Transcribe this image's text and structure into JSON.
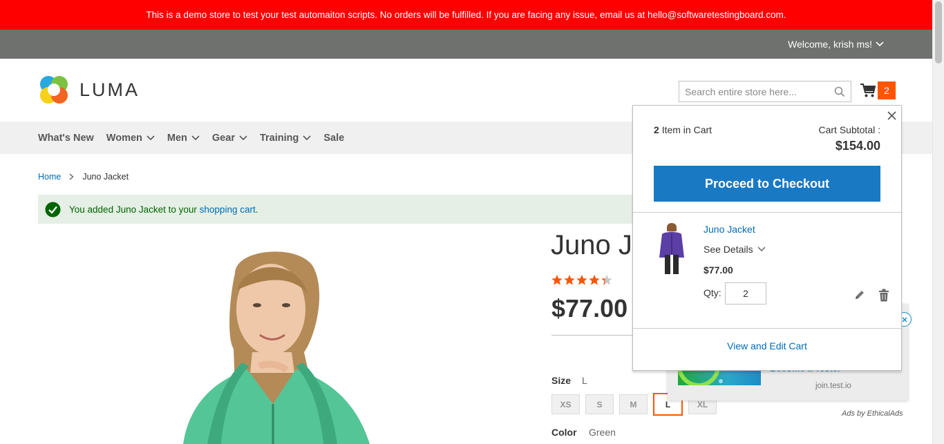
{
  "banner": {
    "text": "This is a demo store to test your test automaiton scripts. No orders will be fulfilled. If you are facing any issue, email us at hello@softwaretestingboard.com."
  },
  "header": {
    "welcome": "Welcome, krish ms!",
    "logo_text": "LUMA",
    "search_placeholder": "Search entire store here...",
    "cart_count": "2"
  },
  "nav": {
    "items": [
      "What's New",
      "Women",
      "Men",
      "Gear",
      "Training",
      "Sale"
    ]
  },
  "breadcrumb": {
    "home": "Home",
    "current": "Juno Jacket"
  },
  "message": {
    "prefix": "You added Juno Jacket to your ",
    "link": "shopping cart",
    "suffix": "."
  },
  "product": {
    "title": "Juno Jacket",
    "price": "$77.00",
    "rating_percent": 86,
    "size_label": "Size",
    "size_value": "L",
    "sizes": [
      "XS",
      "S",
      "M",
      "L",
      "XL"
    ],
    "selected_size": "L",
    "color_label": "Color",
    "color_value": "Green"
  },
  "minicart": {
    "item_count": "2",
    "items_label": "Item in Cart",
    "subtotal_label": "Cart Subtotal :",
    "subtotal": "$154.00",
    "checkout_label": "Proceed to Checkout",
    "item": {
      "name": "Juno Jacket",
      "see_details": "See Details",
      "price": "$77.00",
      "qty_label": "Qty:",
      "qty": "2"
    },
    "view_cart": "View and Edit Cart"
  },
  "ad": {
    "headline": "Become a Tester",
    "domain": "join.test.io",
    "attribution": "Ads by EthicalAds"
  },
  "colors": {
    "banner": "#ff0000",
    "accent": "#ff5501",
    "primary": "#1979c3",
    "link": "#006bb4"
  }
}
